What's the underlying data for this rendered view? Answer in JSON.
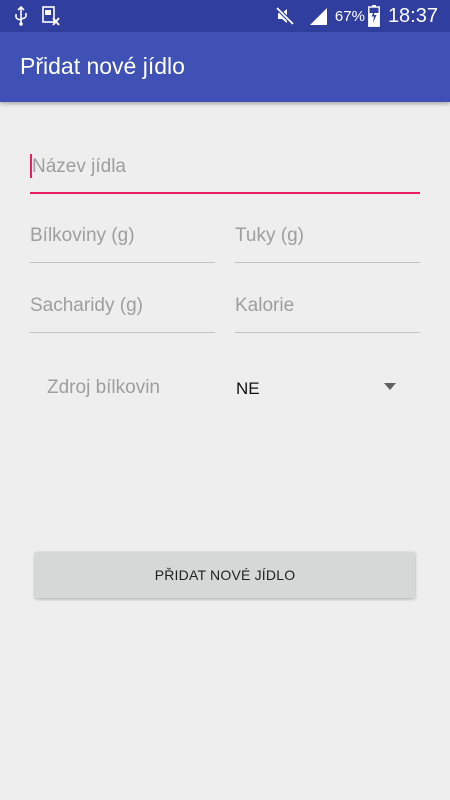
{
  "status_bar": {
    "left_icons": [
      "usb-icon",
      "screenshot-icon"
    ],
    "right_icons": [
      "mute-icon",
      "signal-icon",
      "battery-charging-icon"
    ],
    "battery_percent": "67%",
    "time": "18:37"
  },
  "app_bar": {
    "title": "Přidat nové jídlo"
  },
  "form": {
    "name_hint": "Název jídla",
    "protein_hint": "Bílkoviny (g)",
    "fat_hint": "Tuky (g)",
    "carbs_hint": "Sacharidy (g)",
    "calories_hint": "Kalorie",
    "protein_source_label": "Zdroj bílkovin",
    "protein_source_value": "NE",
    "submit_label": "PŘIDAT NOVÉ JÍDLO"
  },
  "colors": {
    "status_bar": "#303f9f",
    "app_bar": "#3f51b5",
    "accent": "#e91e63",
    "background": "#eeeeee"
  }
}
